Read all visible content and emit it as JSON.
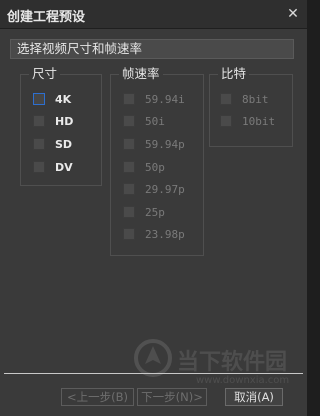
{
  "window": {
    "title": "创建工程预设",
    "close_glyph": "✕"
  },
  "section": {
    "header": "选择视频尺寸和帧速率"
  },
  "size_group": {
    "label": "尺寸",
    "options": [
      {
        "label": "4K",
        "selected": true
      },
      {
        "label": "HD",
        "selected": false
      },
      {
        "label": "SD",
        "selected": false
      },
      {
        "label": "DV",
        "selected": false
      }
    ]
  },
  "fps_group": {
    "label": "帧速率",
    "options": [
      {
        "label": "59.94i"
      },
      {
        "label": "50i"
      },
      {
        "label": "59.94p"
      },
      {
        "label": "50p"
      },
      {
        "label": "29.97p"
      },
      {
        "label": "25p"
      },
      {
        "label": "23.98p"
      }
    ]
  },
  "bit_group": {
    "label": "比特",
    "options": [
      {
        "label": "8bit"
      },
      {
        "label": "10bit"
      }
    ]
  },
  "buttons": {
    "prev": "<上一步(B)",
    "next": "下一步(N)>",
    "cancel": "取消(A)"
  },
  "watermark": {
    "text": "当下软件园",
    "url": "www.downxia.com"
  },
  "colors": {
    "selection_border": "#2d6fd0",
    "background": "#3a3a3a"
  }
}
